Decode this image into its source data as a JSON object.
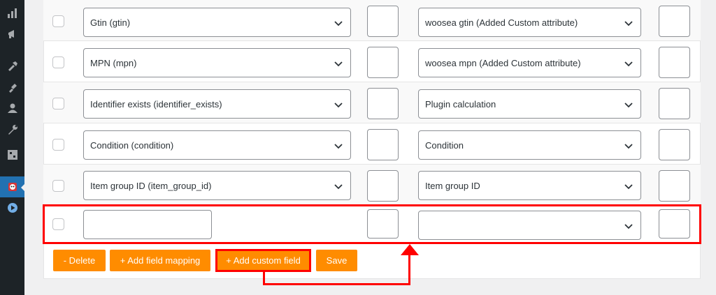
{
  "sidebar": {
    "icons": [
      "chart-bar-icon",
      "megaphone-icon",
      "hammer-icon",
      "plug-icon",
      "user-icon",
      "wrench-icon",
      "grid-icon",
      "plugin-face-icon",
      "play-circle-icon"
    ]
  },
  "rows": [
    {
      "field": "Gtin (gtin)",
      "value": "woosea gtin (Added Custom attribute)"
    },
    {
      "field": "MPN (mpn)",
      "value": "woosea mpn (Added Custom attribute)"
    },
    {
      "field": "Identifier exists (identifier_exists)",
      "value": "Plugin calculation"
    },
    {
      "field": "Condition (condition)",
      "value": "Condition"
    },
    {
      "field": "Item group ID (item_group_id)",
      "value": "Item group ID"
    }
  ],
  "new_row": {
    "field_value": "",
    "value": ""
  },
  "buttons": {
    "delete": "- Delete",
    "add_field_mapping": "+ Add field mapping",
    "add_custom_field": "+ Add custom field",
    "save": "Save"
  },
  "colors": {
    "accent": "#ff8c00",
    "highlight": "#ff0000",
    "sidebar": "#1d2327",
    "active": "#2271b1"
  }
}
